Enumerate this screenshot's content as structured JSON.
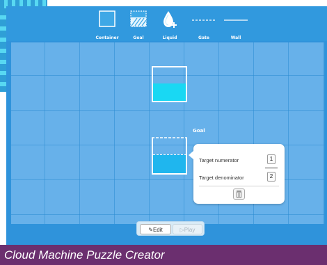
{
  "toolbar": {
    "tools": [
      {
        "label": "Container",
        "icon": "container-icon"
      },
      {
        "label": "Goal",
        "icon": "goal-hatch-icon"
      },
      {
        "label": "Liquid",
        "icon": "liquid-drop-add-icon"
      },
      {
        "label": "Gate",
        "icon": "gate-dashed-line-icon"
      },
      {
        "label": "Wall",
        "icon": "wall-line-icon"
      }
    ]
  },
  "board": {
    "goal_label": "Goal"
  },
  "goal_popup": {
    "numerator_label": "Target numerator",
    "numerator_value": "1",
    "denominator_label": "Target denominator",
    "denominator_value": "2",
    "delete_icon": "trash-icon"
  },
  "mode": {
    "edit_label": "Edit",
    "play_label": "Play",
    "active": "edit"
  },
  "caption": "Cloud Machine Puzzle Creator",
  "colors": {
    "background": "#2f93db",
    "grid": "#67b1ea",
    "liquid": "#19d8f3",
    "caption_bar": "#6b2f6f"
  }
}
